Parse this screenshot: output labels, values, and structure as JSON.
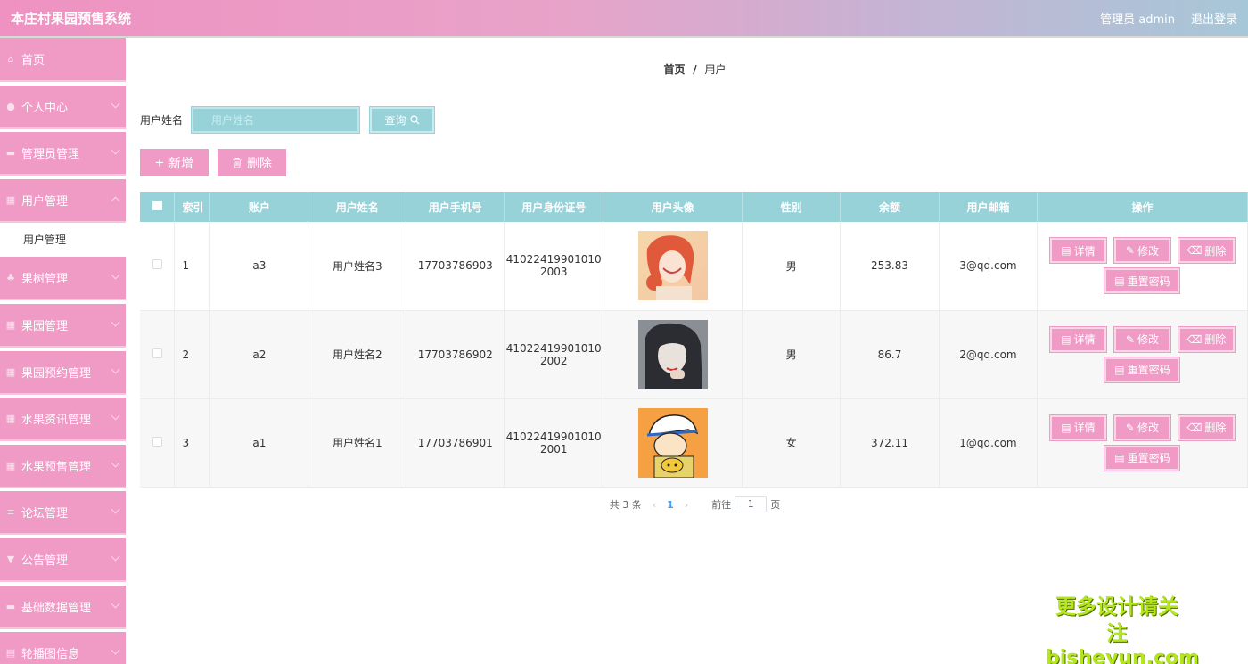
{
  "app": {
    "title": "本庄村果园预售系统",
    "user_label": "管理员 admin",
    "logout_label": "退出登录"
  },
  "colors": {
    "primary_pink": "#f09ac6",
    "teal": "#97d2d9",
    "page_active": "#409eff"
  },
  "sidebar": {
    "items": [
      {
        "label": "首页",
        "icon": "home-icon"
      },
      {
        "label": "个人中心",
        "icon": "user-icon"
      },
      {
        "label": "管理员管理",
        "icon": "admin-icon"
      },
      {
        "label": "用户管理",
        "icon": "grid-icon"
      },
      {
        "label": "果树管理",
        "icon": "tree-icon"
      },
      {
        "label": "果园管理",
        "icon": "grid-icon"
      },
      {
        "label": "果园预约管理",
        "icon": "grid-icon"
      },
      {
        "label": "水果资讯管理",
        "icon": "grid-icon"
      },
      {
        "label": "水果预售管理",
        "icon": "grid-icon"
      },
      {
        "label": "论坛管理",
        "icon": "list-icon"
      },
      {
        "label": "公告管理",
        "icon": "notice-icon"
      },
      {
        "label": "基础数据管理",
        "icon": "data-icon"
      },
      {
        "label": "轮播图信息",
        "icon": "image-icon"
      }
    ],
    "active_submenu": "用户管理"
  },
  "breadcrumb": {
    "home": "首页",
    "separator": "/",
    "current": "用户"
  },
  "search": {
    "label": "用户姓名",
    "placeholder": "用户姓名",
    "value": "",
    "query_label": "查询"
  },
  "toolbar": {
    "add_label": "新增",
    "delete_label": "删除"
  },
  "table": {
    "headers": [
      "索引",
      "账户",
      "用户姓名",
      "用户手机号",
      "用户身份证号",
      "用户头像",
      "性别",
      "余额",
      "用户邮箱",
      "操作"
    ],
    "rows": [
      {
        "index": "1",
        "account": "a3",
        "name": "用户姓名3",
        "phone": "17703786903",
        "id_line1": "41022419901010",
        "id_line2": "2003",
        "gender": "男",
        "balance": "253.83",
        "email": "3@qq.com"
      },
      {
        "index": "2",
        "account": "a2",
        "name": "用户姓名2",
        "phone": "17703786902",
        "id_line1": "41022419901010",
        "id_line2": "2002",
        "gender": "男",
        "balance": "86.7",
        "email": "2@qq.com"
      },
      {
        "index": "3",
        "account": "a1",
        "name": "用户姓名1",
        "phone": "17703786901",
        "id_line1": "41022419901010",
        "id_line2": "2001",
        "gender": "女",
        "balance": "372.11",
        "email": "1@qq.com"
      }
    ],
    "ops": {
      "detail": "详情",
      "edit": "修改",
      "delete": "删除",
      "reset": "重置密码"
    }
  },
  "pagination": {
    "total": "共 3 条",
    "current": "1",
    "goto_prefix": "前往",
    "goto_value": "1",
    "goto_suffix": "页"
  },
  "watermark": {
    "line1": "更多设计请关注",
    "line2": "bisheyun.com"
  }
}
